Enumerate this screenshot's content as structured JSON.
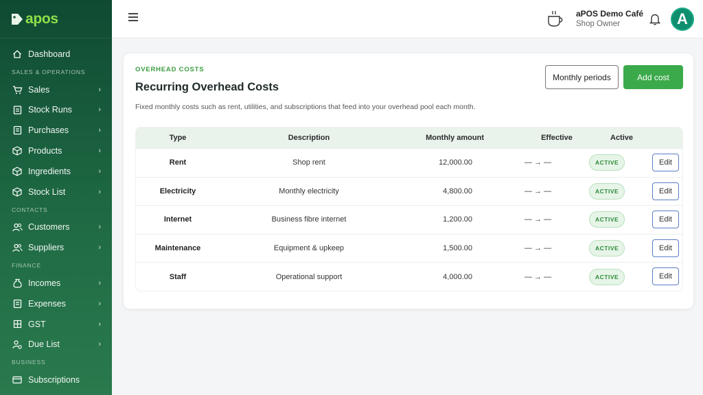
{
  "brand": {
    "name": "apos",
    "accent": "#8ee04a"
  },
  "sidebar": {
    "items": [
      {
        "label": "Dashboard",
        "icon": "home-icon"
      },
      {
        "section": "SALES & OPERATIONS"
      },
      {
        "label": "Sales",
        "icon": "cart-icon"
      },
      {
        "label": "Stock Runs",
        "icon": "clipboard-icon"
      },
      {
        "label": "Purchases",
        "icon": "receipt-icon"
      },
      {
        "label": "Products",
        "icon": "box-icon"
      },
      {
        "label": "Ingredients",
        "icon": "cube-icon"
      },
      {
        "label": "Stock List",
        "icon": "box-icon"
      },
      {
        "section": "CONTACTS"
      },
      {
        "label": "Customers",
        "icon": "users-icon"
      },
      {
        "label": "Suppliers",
        "icon": "users-icon"
      },
      {
        "section": "FINANCE"
      },
      {
        "label": "Incomes",
        "icon": "money-bag-icon"
      },
      {
        "label": "Expenses",
        "icon": "receipt-icon"
      },
      {
        "label": "GST",
        "icon": "grid-icon"
      },
      {
        "label": "Due List",
        "icon": "user-clock-icon"
      },
      {
        "section": "BUSINESS"
      },
      {
        "label": "Subscriptions",
        "icon": "card-icon"
      }
    ]
  },
  "header": {
    "shop_name": "aPOS Demo Café",
    "role": "Shop Owner",
    "avatar_letter": "A"
  },
  "card": {
    "eyebrow": "OVERHEAD COSTS",
    "title": "Recurring Overhead Costs",
    "description": "Fixed monthly costs such as rent, utilities, and subscriptions that feed into your overhead pool each month.",
    "btn_periods": "Monthly periods",
    "btn_add": "Add cost"
  },
  "table": {
    "headers": {
      "type": "Type",
      "description": "Description",
      "amount": "Monthly amount",
      "effective": "Effective",
      "active": "Active"
    },
    "rows": [
      {
        "type": "Rent",
        "description": "Shop rent",
        "amount": "12,000.00",
        "effective": "— → —",
        "status": "ACTIVE",
        "action": "Edit"
      },
      {
        "type": "Electricity",
        "description": "Monthly electricity",
        "amount": "4,800.00",
        "effective": "— → —",
        "status": "ACTIVE",
        "action": "Edit"
      },
      {
        "type": "Internet",
        "description": "Business fibre internet",
        "amount": "1,200.00",
        "effective": "— → —",
        "status": "ACTIVE",
        "action": "Edit"
      },
      {
        "type": "Maintenance",
        "description": "Equipment & upkeep",
        "amount": "1,500.00",
        "effective": "— → —",
        "status": "ACTIVE",
        "action": "Edit"
      },
      {
        "type": "Staff",
        "description": "Operational support",
        "amount": "4,000.00",
        "effective": "— → —",
        "status": "ACTIVE",
        "action": "Edit"
      }
    ]
  }
}
